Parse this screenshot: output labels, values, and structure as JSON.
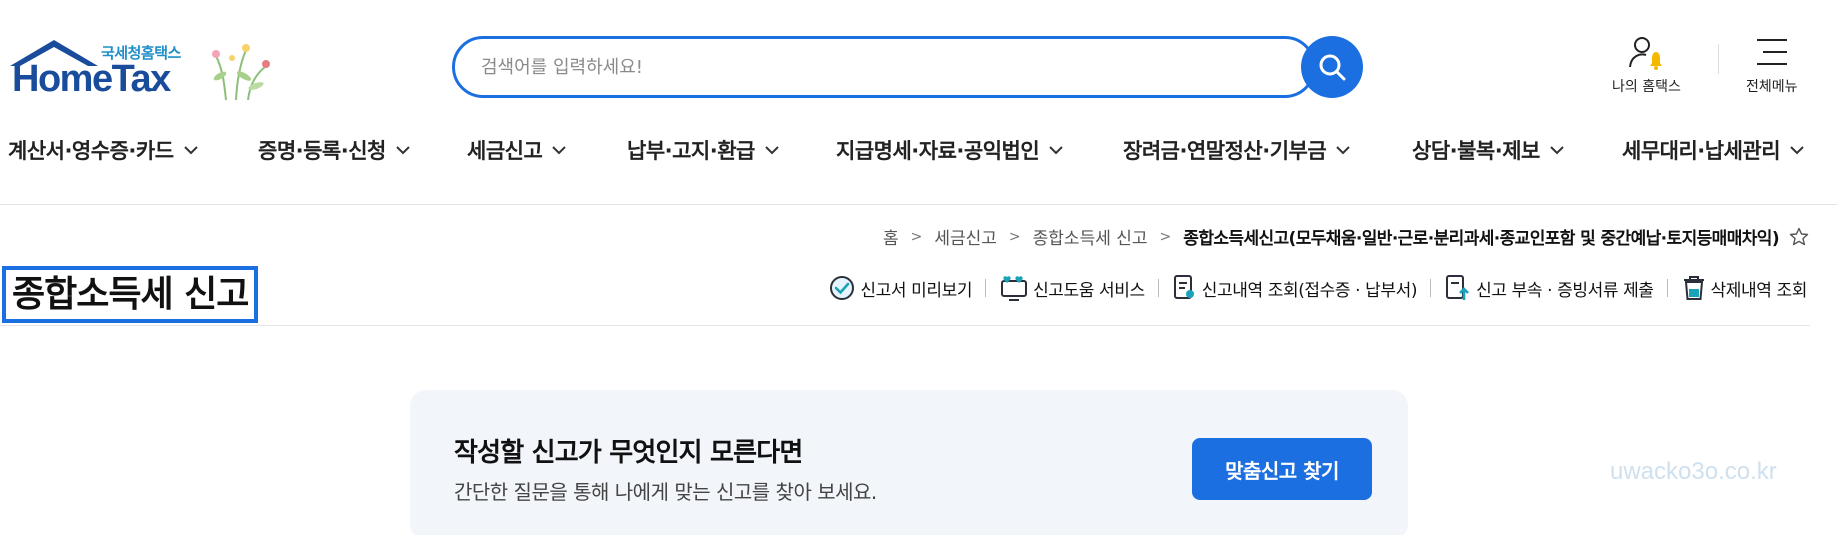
{
  "header": {
    "logo_sub": "국세청홈택스",
    "logo_main": "HomeTax",
    "search_placeholder": "검색어를 입력하세요!",
    "my_hometax": "나의 홈택스",
    "all_menu": "전체메뉴"
  },
  "nav": {
    "items": [
      {
        "label": "계산서·영수증·카드"
      },
      {
        "label": "증명·등록·신청"
      },
      {
        "label": "세금신고"
      },
      {
        "label": "납부·고지·환급"
      },
      {
        "label": "지급명세·자료·공익법인"
      },
      {
        "label": "장려금·연말정산·기부금"
      },
      {
        "label": "상담·불복·제보"
      },
      {
        "label": "세무대리·납세관리"
      }
    ]
  },
  "breadcrumb": {
    "home": "홈",
    "level1": "세금신고",
    "level2": "종합소득세 신고",
    "current": "종합소득세신고(모두채움·일반·근로·분리과세·종교인포함 및 중간예납·토지등매매차익)"
  },
  "page": {
    "title": "종합소득세 신고"
  },
  "actions": [
    {
      "label": "신고서 미리보기"
    },
    {
      "label": "신고도움 서비스"
    },
    {
      "label": "신고내역 조회(접수증 · 납부서)"
    },
    {
      "label": "신고 부속 · 증빙서류 제출"
    },
    {
      "label": "삭제내역 조회"
    }
  ],
  "info_box": {
    "title": "작성할 신고가 무엇인지 모른다면",
    "description": "간단한 질문을 통해 나에게 맞는 신고를 찾아 보세요.",
    "button_label": "맞춤신고 찾기"
  },
  "watermark": "uwacko3o.co.kr",
  "colors": {
    "primary": "#1c6fe0",
    "logo": "#1a4c9c",
    "info_bg": "#f2f5fa"
  }
}
